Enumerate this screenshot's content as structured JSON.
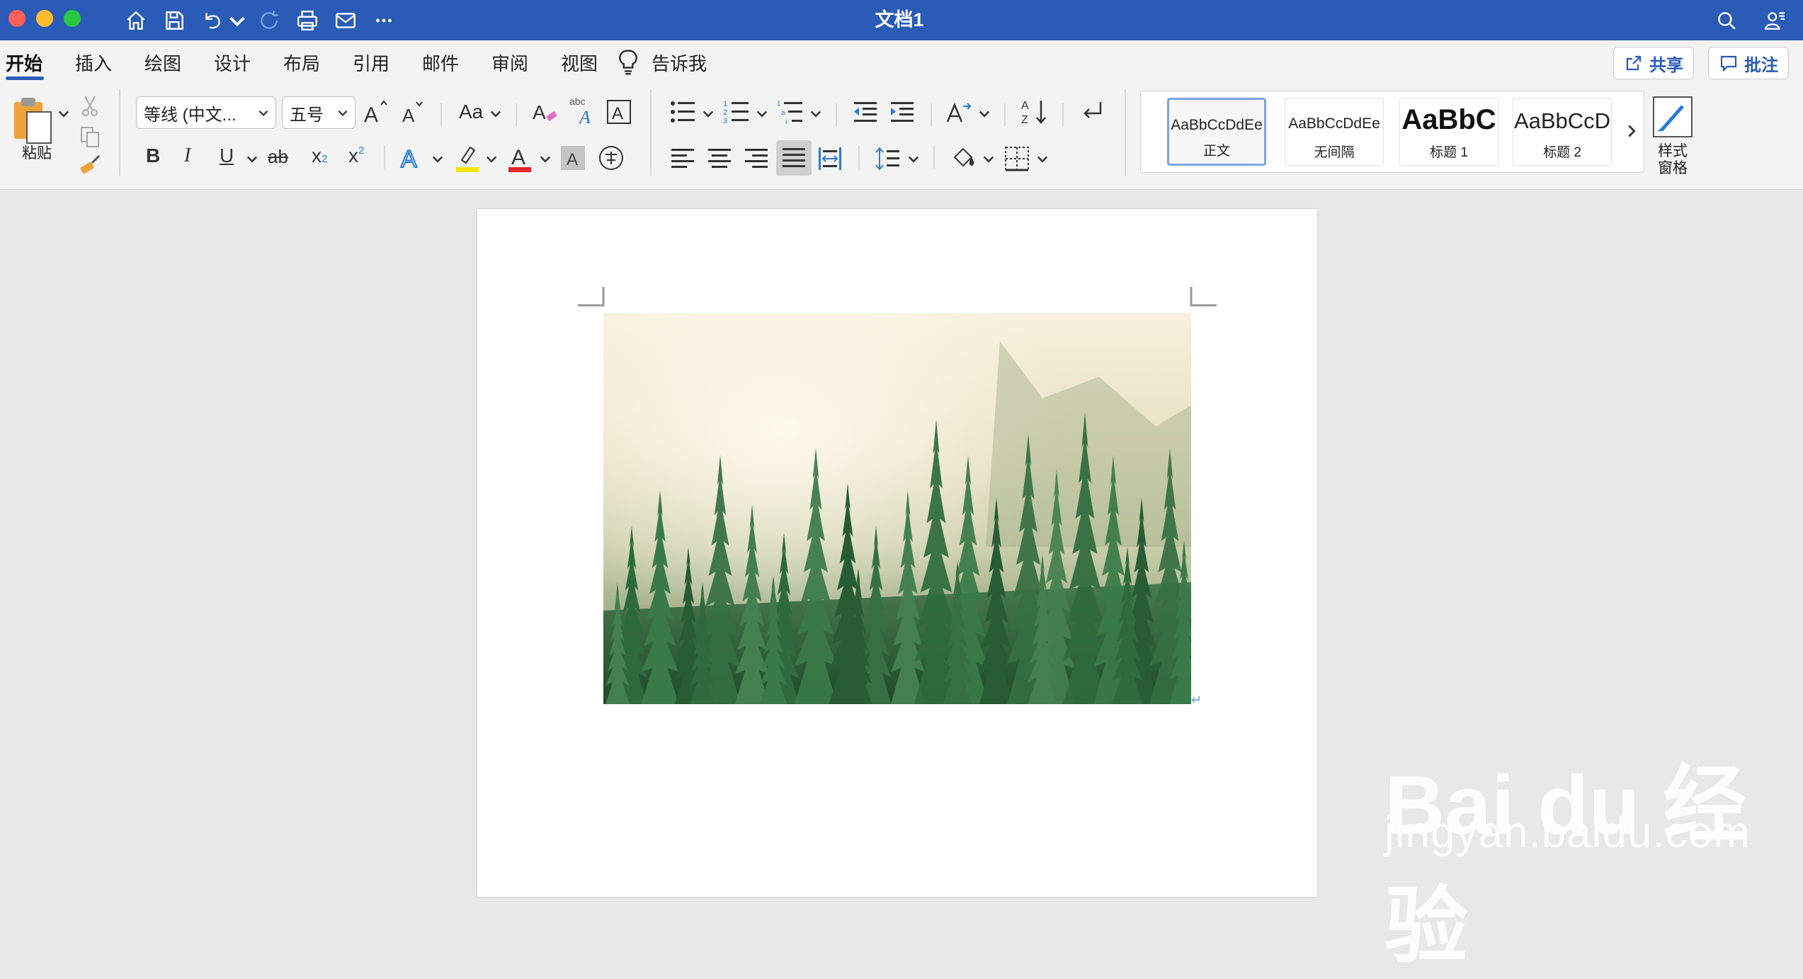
{
  "window": {
    "title": "文档1"
  },
  "ribbon_tabs": [
    {
      "label": "开始",
      "active": true
    },
    {
      "label": "插入"
    },
    {
      "label": "绘图"
    },
    {
      "label": "设计"
    },
    {
      "label": "布局"
    },
    {
      "label": "引用"
    },
    {
      "label": "邮件"
    },
    {
      "label": "审阅"
    },
    {
      "label": "视图"
    }
  ],
  "tell_me": "告诉我",
  "share_button": "共享",
  "comments_button": "批注",
  "clipboard": {
    "paste_label": "粘贴"
  },
  "font": {
    "name": "等线 (中文...",
    "size": "五号",
    "change_case": "Aa",
    "bold": "B",
    "italic": "I",
    "underline": "U",
    "strike": "ab",
    "subscript": "x",
    "superscript": "x"
  },
  "styles": [
    {
      "sample": "AaBbCcDdEe",
      "name": "正文",
      "active": true
    },
    {
      "sample": "AaBbCcDdEe",
      "name": "无间隔"
    },
    {
      "sample": "AaBbC",
      "name": "标题 1"
    },
    {
      "sample": "AaBbCcD",
      "name": "标题 2"
    }
  ],
  "styles_pane": {
    "line1": "样式",
    "line2": "窗格"
  },
  "colors": {
    "titlebar": "#2a5bb7",
    "accent": "#2a5bb7",
    "highlight": "#f5e400",
    "font_color": "#e0262b",
    "text_effects": "#2a7bd6"
  },
  "watermark": {
    "logo": "Bai du 经验",
    "url": "jingyan.baidu.com"
  }
}
